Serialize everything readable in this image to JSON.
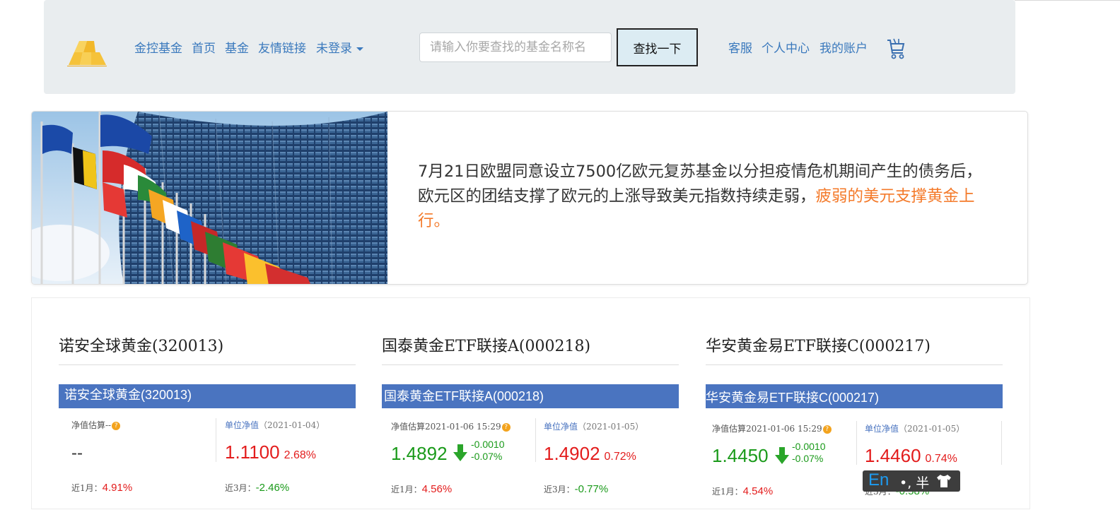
{
  "nav": {
    "brand": "金控基金",
    "home": "首页",
    "funds": "基金",
    "links": "友情链接",
    "login": "未登录",
    "search_placeholder": "请输入你要查找的基金名称名",
    "search_button": "查找一下",
    "service": "客服",
    "personal_center": "个人中心",
    "my_account": "我的账户",
    "cart_icon": "shopping-cart-icon"
  },
  "banner": {
    "text": "7月21日欧盟同意设立7500亿欧元复苏基金以分担疫情危机期间产生的债务后，欧元区的团结支撑了欧元的上涨导致美元指数持续走弱，",
    "highlight": "疲弱的美元支撑黄金上行。"
  },
  "funds": [
    {
      "title": "诺安全球黄金(320013)",
      "bar_title": "诺安全球黄金(320013)",
      "est_label": "净值估算--",
      "est_value": "--",
      "est_change_abs": "",
      "est_change_pct": "",
      "unit_label": "单位净值",
      "unit_date": "（2021-01-04）",
      "unit_value": "1.1100",
      "unit_pct": "2.68%",
      "m1_label": "近1月：",
      "m1_value": "4.91%",
      "m3_label": "近3月：",
      "m3_value": "-2.46%"
    },
    {
      "title": "国泰黄金ETF联接A(000218)",
      "bar_title": "国泰黄金ETF联接A(000218)",
      "est_label": "净值估算2021-01-06 15:29",
      "est_value": "1.4892",
      "est_change_abs": "-0.0010",
      "est_change_pct": "-0.07%",
      "unit_label": "单位净值",
      "unit_date": "（2021-01-05）",
      "unit_value": "1.4902",
      "unit_pct": "0.72%",
      "m1_label": "近1月：",
      "m1_value": "4.56%",
      "m3_label": "近3月：",
      "m3_value": "-0.77%"
    },
    {
      "title": "华安黄金易ETF联接C(000217)",
      "bar_title": "华安黄金易ETF联接C(000217)",
      "est_label": "净值估算2021-01-06 15:29",
      "est_value": "1.4450",
      "est_change_abs": "-0.0010",
      "est_change_pct": "-0.07%",
      "unit_label": "单位净值",
      "unit_date": "（2021-01-05）",
      "unit_value": "1.4460",
      "unit_pct": "0.74%",
      "m1_label": "近1月：",
      "m1_value": "4.54%",
      "m3_label": "近3月：",
      "m3_value": "-0.58%"
    }
  ],
  "ime": {
    "mode": "En",
    "symbols": "•, 半"
  },
  "colors": {
    "link": "#3a79bd",
    "highlight": "#f47a2a",
    "bar": "#4a74c0",
    "up": "#e31c1c",
    "down": "#1a9a1a"
  }
}
